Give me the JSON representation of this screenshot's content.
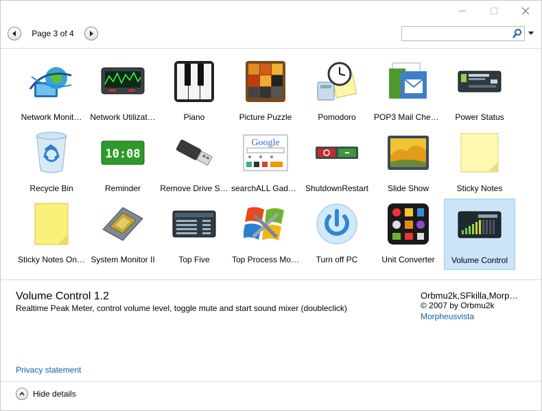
{
  "window": {
    "controls": [
      "minimize",
      "maximize",
      "close"
    ]
  },
  "toolbar": {
    "page_label": "Page 3 of 4",
    "prev_icon": "left-arrow-icon",
    "next_icon": "right-arrow-icon",
    "search": {
      "value": "",
      "placeholder": "",
      "icon": "magnifier-icon"
    }
  },
  "gadgets": [
    {
      "label": "Network Monit…",
      "icon": "network-globe-icon"
    },
    {
      "label": "Network Utilizat…",
      "icon": "network-graph-icon"
    },
    {
      "label": "Piano",
      "icon": "piano-keys-icon"
    },
    {
      "label": "Picture Puzzle",
      "icon": "picture-puzzle-icon"
    },
    {
      "label": "Pomodoro",
      "icon": "clock-note-icon"
    },
    {
      "label": "POP3 Mail Chec…",
      "icon": "mail-icon"
    },
    {
      "label": "Power Status",
      "icon": "battery-icon"
    },
    {
      "label": "Recycle Bin",
      "icon": "recycle-bin-icon"
    },
    {
      "label": "Reminder",
      "icon": "digital-clock-icon",
      "clock_text": "10:08"
    },
    {
      "label": "Remove Drive S…",
      "icon": "usb-drive-icon"
    },
    {
      "label": "searchALL Gadg…",
      "icon": "google-search-icon",
      "logo_text": "Google"
    },
    {
      "label": "ShutdownRestart",
      "icon": "shutdown-icon"
    },
    {
      "label": "Slide Show",
      "icon": "slideshow-icon"
    },
    {
      "label": "Sticky Notes",
      "icon": "sticky-note-icon"
    },
    {
      "label": "Sticky Notes On…",
      "icon": "sticky-note-yellow-icon"
    },
    {
      "label": "System Monitor II",
      "icon": "cpu-chip-icon"
    },
    {
      "label": "Top Five",
      "icon": "process-list-icon"
    },
    {
      "label": "Top Process Mo…",
      "icon": "windows-tools-icon"
    },
    {
      "label": "Turn off PC",
      "icon": "power-button-icon"
    },
    {
      "label": "Unit Converter",
      "icon": "unit-converter-icon"
    },
    {
      "label": "Volume Control",
      "icon": "volume-meter-icon",
      "selected": true
    }
  ],
  "details": {
    "title": "Volume Control 1.2",
    "description": "Realtime Peak Meter, control volume level, toggle mute and start sound mixer (doubleclick)",
    "author": "Orbmu2k,SFkilla,Morp…",
    "copyright": "© 2007 by Orbmu2k",
    "website": "Morpheusvista",
    "privacy": "Privacy statement",
    "hide_label": "Hide details"
  },
  "colors": {
    "link": "#0f5ea8",
    "selection": "#cce4f7",
    "selection_border": "#99c9ef"
  }
}
